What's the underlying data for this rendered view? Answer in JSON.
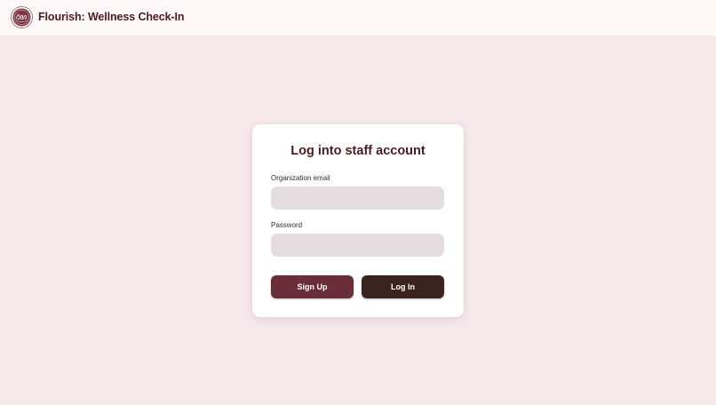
{
  "header": {
    "title": "Flourish: Wellness Check-In",
    "logo_icon": "flourish-logo-icon"
  },
  "login_card": {
    "title": "Log into staff account",
    "email_label": "Organization email",
    "email_value": "",
    "email_placeholder": "",
    "password_label": "Password",
    "password_value": "",
    "password_placeholder": "",
    "signup_label": "Sign Up",
    "login_label": "Log In"
  },
  "colors": {
    "page_background": "#f5e8ea",
    "header_background": "#fdf7f8",
    "brand_text": "#4a1c22",
    "signup_button": "#6b2d3a",
    "login_button": "#3b2420",
    "input_background": "#e5dde0"
  }
}
